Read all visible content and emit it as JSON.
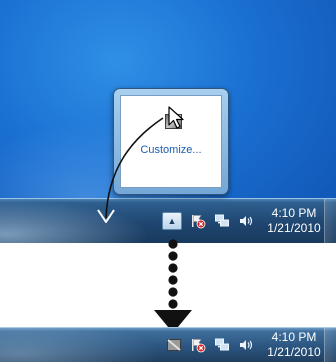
{
  "popup": {
    "customize_label": "Customize...",
    "icons": [
      "hidden-tray-icon"
    ]
  },
  "taskbar_before": {
    "tray_icons": [
      "chevron-up-icon",
      "action-center-flag-icon",
      "network-icon",
      "volume-icon"
    ],
    "clock": {
      "time": "4:10 PM",
      "date": "1/21/2010"
    }
  },
  "taskbar_after": {
    "tray_icons": [
      "hidden-tray-icon",
      "action-center-flag-icon",
      "network-icon",
      "volume-icon"
    ],
    "clock": {
      "time": "4:10 PM",
      "date": "1/21/2010"
    }
  },
  "colors": {
    "desktop_blue": "#1a6fd1",
    "taskbar_dark": "#1f4670",
    "link_blue": "#1a5fb4",
    "flag_red": "#d42020",
    "arrow_black": "#111111"
  }
}
